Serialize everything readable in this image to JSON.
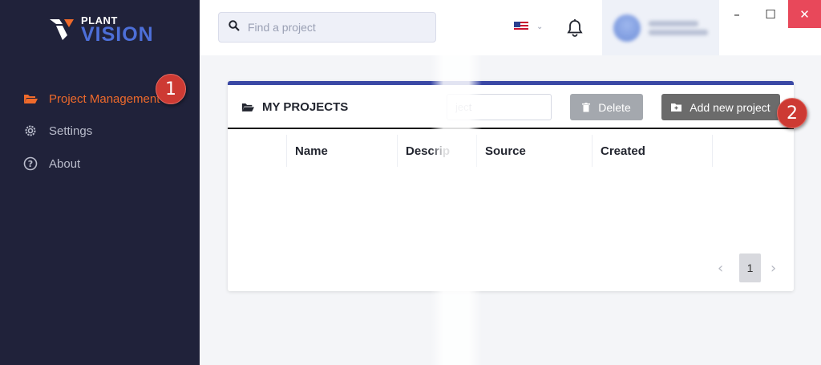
{
  "brand": {
    "word_top": "PLANT",
    "word_bottom": "VISION",
    "accent": "#4d6fd8"
  },
  "sidebar": {
    "items": [
      {
        "label": "Project Management",
        "icon": "folder-open-icon",
        "active": true
      },
      {
        "label": "Settings",
        "icon": "gear-icon",
        "active": false
      },
      {
        "label": "About",
        "icon": "help-circle-icon",
        "active": false
      }
    ],
    "active_color": "#ef6a2b",
    "background": "#20223a"
  },
  "topbar": {
    "search_placeholder": "Find a project",
    "language": "en-US",
    "language_icon": "us-flag-icon"
  },
  "window": {
    "minimize": "–",
    "maximize": "☐",
    "close": "✕"
  },
  "panel": {
    "title": "MY PROJECTS",
    "search_placeholder": "ject",
    "delete_label": "Delete",
    "add_label": "Add new project",
    "columns": [
      "",
      "Name",
      "Descrip",
      "Source",
      "Created"
    ],
    "rows": [],
    "page": "1",
    "accent": "#3a48a5"
  },
  "callouts": [
    "1",
    "2"
  ]
}
